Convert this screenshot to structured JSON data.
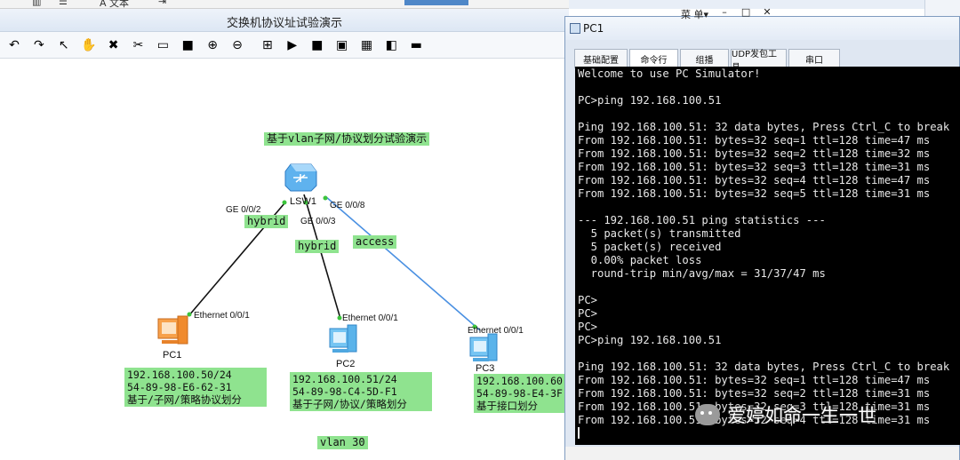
{
  "top_strip": {
    "text_label": "A 文本"
  },
  "main_window": {
    "title": "交换机协议址试验演示"
  },
  "toolbar": {
    "items": [
      {
        "icon": "undo-icon",
        "glyph": "↶"
      },
      {
        "icon": "redo-icon",
        "glyph": "↷"
      },
      {
        "icon": "select-pointer-icon",
        "glyph": "↖"
      },
      {
        "icon": "pan-hand-icon",
        "glyph": "✋"
      },
      {
        "icon": "delete-icon",
        "glyph": "✖"
      },
      {
        "icon": "delete-connection-icon",
        "glyph": "✂"
      },
      {
        "icon": "text-note-icon",
        "glyph": "▭"
      },
      {
        "icon": "rectangle-icon",
        "glyph": "■"
      },
      {
        "icon": "zoom-in-icon",
        "glyph": "⊕"
      },
      {
        "icon": "zoom-out-icon",
        "glyph": "⊖"
      },
      {
        "icon": "fit-view-icon",
        "glyph": "⊞"
      },
      {
        "icon": "start-all-icon",
        "glyph": "▶"
      },
      {
        "icon": "stop-all-icon",
        "glyph": "■"
      },
      {
        "icon": "capture-icon",
        "glyph": "▣"
      },
      {
        "icon": "grid-icon",
        "glyph": "▦"
      },
      {
        "icon": "topology-icon",
        "glyph": "◧"
      },
      {
        "icon": "console-icon",
        "glyph": "▬"
      }
    ]
  },
  "topology": {
    "title": "基于vlan子网/协议划分试验演示",
    "switch": {
      "name": "LSW1"
    },
    "ports": {
      "ge002": "GE 0/0/2",
      "ge003": "GE 0/0/3",
      "ge008": "GE 0/0/8",
      "pc1_eth": "Ethernet 0/0/1",
      "pc2_eth": "Ethernet 0/0/1",
      "pc3_eth": "Ethernet 0/0/1"
    },
    "link_labels": {
      "hybrid1": "hybrid",
      "hybrid2": "hybrid",
      "access": "access"
    },
    "pcs": [
      {
        "name": "PC1",
        "lines": [
          "192.168.100.50/24",
          "54-89-98-E6-62-31",
          "基于/子网/策略协议划分"
        ]
      },
      {
        "name": "PC2",
        "lines": [
          "192.168.100.51/24",
          "54-89-98-C4-5D-F1",
          "基于子网/协议/策略划分"
        ]
      },
      {
        "name": "PC3",
        "lines": [
          "192.168.100.60",
          "54-89-98-E4-3F",
          "基于接口划分"
        ]
      }
    ],
    "vlan_label": "vlan 30",
    "colors": {
      "label_bg": "#8fe38f",
      "access_link": "#4a90e2",
      "hybrid_link": "#111111",
      "port_dot": "#3cc43c"
    }
  },
  "pc_window": {
    "title": "PC1",
    "menu_label": "菜 单▾",
    "min_glyph": "–",
    "max_glyph": "□",
    "close_glyph": "✕",
    "tabs": [
      "基础配置",
      "命令行",
      "组播",
      "UDP发包工具",
      "串口"
    ],
    "active_tab": "命令行",
    "console_lines": [
      "Welcome to use PC Simulator!",
      "",
      "PC>ping 192.168.100.51",
      "",
      "Ping 192.168.100.51: 32 data bytes, Press Ctrl_C to break",
      "From 192.168.100.51: bytes=32 seq=1 ttl=128 time=47 ms",
      "From 192.168.100.51: bytes=32 seq=2 ttl=128 time=32 ms",
      "From 192.168.100.51: bytes=32 seq=3 ttl=128 time=31 ms",
      "From 192.168.100.51: bytes=32 seq=4 ttl=128 time=47 ms",
      "From 192.168.100.51: bytes=32 seq=5 ttl=128 time=31 ms",
      "",
      "--- 192.168.100.51 ping statistics ---",
      "  5 packet(s) transmitted",
      "  5 packet(s) received",
      "  0.00% packet loss",
      "  round-trip min/avg/max = 31/37/47 ms",
      "",
      "PC>",
      "PC>",
      "PC>",
      "PC>ping 192.168.100.51",
      "",
      "Ping 192.168.100.51: 32 data bytes, Press Ctrl_C to break",
      "From 192.168.100.51: bytes=32 seq=1 ttl=128 time=47 ms",
      "From 192.168.100.51: bytes=32 seq=2 ttl=128 time=31 ms",
      "From 192.168.100.51: bytes=32 seq=3 ttl=128 time=31 ms",
      "From 192.168.100.51: bytes=32 seq=4 ttl=128 time=31 ms"
    ]
  },
  "watermark": {
    "text": "爱婷如命一生一世"
  }
}
